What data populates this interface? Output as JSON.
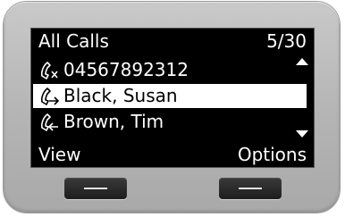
{
  "header": {
    "title": "All Calls",
    "count": "5/30"
  },
  "call_list": [
    {
      "label": "04567892312",
      "icon": "missed-call-icon",
      "selected": false
    },
    {
      "label": "Black, Susan",
      "icon": "outgoing-call-icon",
      "selected": true
    },
    {
      "label": "Brown, Tim",
      "icon": "incoming-call-icon",
      "selected": false
    }
  ],
  "softkeys": {
    "left_label": "View",
    "right_label": "Options"
  },
  "colors": {
    "screen_bg": "#000000",
    "screen_text": "#ffffff",
    "selection_bg": "#ffffff",
    "bezel": "#b8b8b8"
  }
}
